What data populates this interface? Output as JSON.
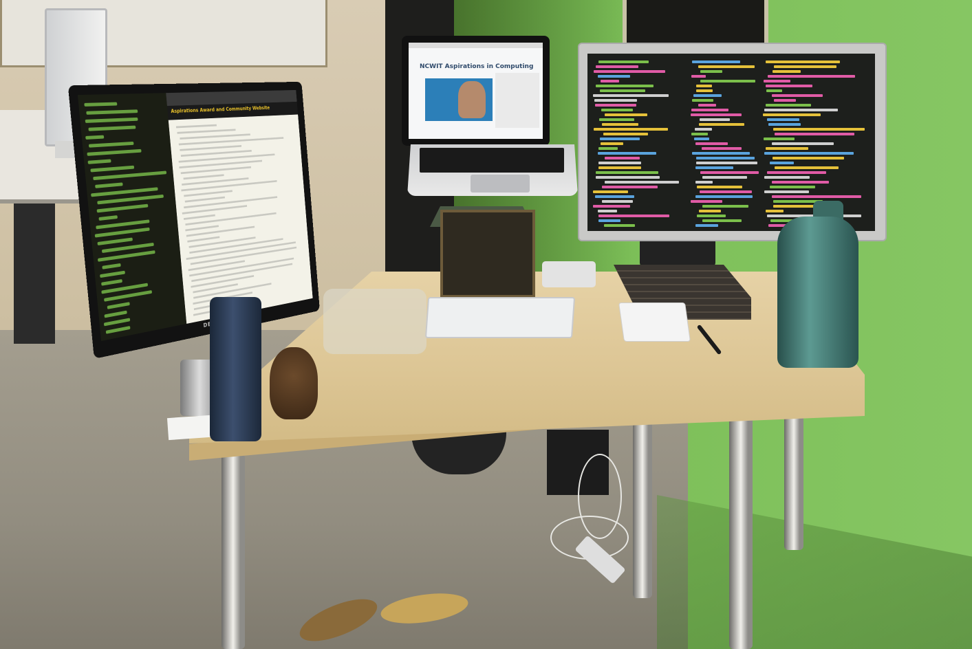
{
  "scene": {
    "description_label": "",
    "left_monitor": {
      "brand": "DELL",
      "page_heading": "Aspirations Award and Community Website"
    },
    "laptop": {
      "page_heading": "NCWIT Aspirations in Computing"
    },
    "colors": {
      "wall_green": "#7ec05a",
      "desk": "#dcc594",
      "terminal_bg": "#1d1f1c",
      "code_green": "#7bbf4b",
      "code_yellow": "#e5c13a",
      "code_pink": "#e05ba6",
      "code_blue": "#5aa3dd"
    }
  }
}
